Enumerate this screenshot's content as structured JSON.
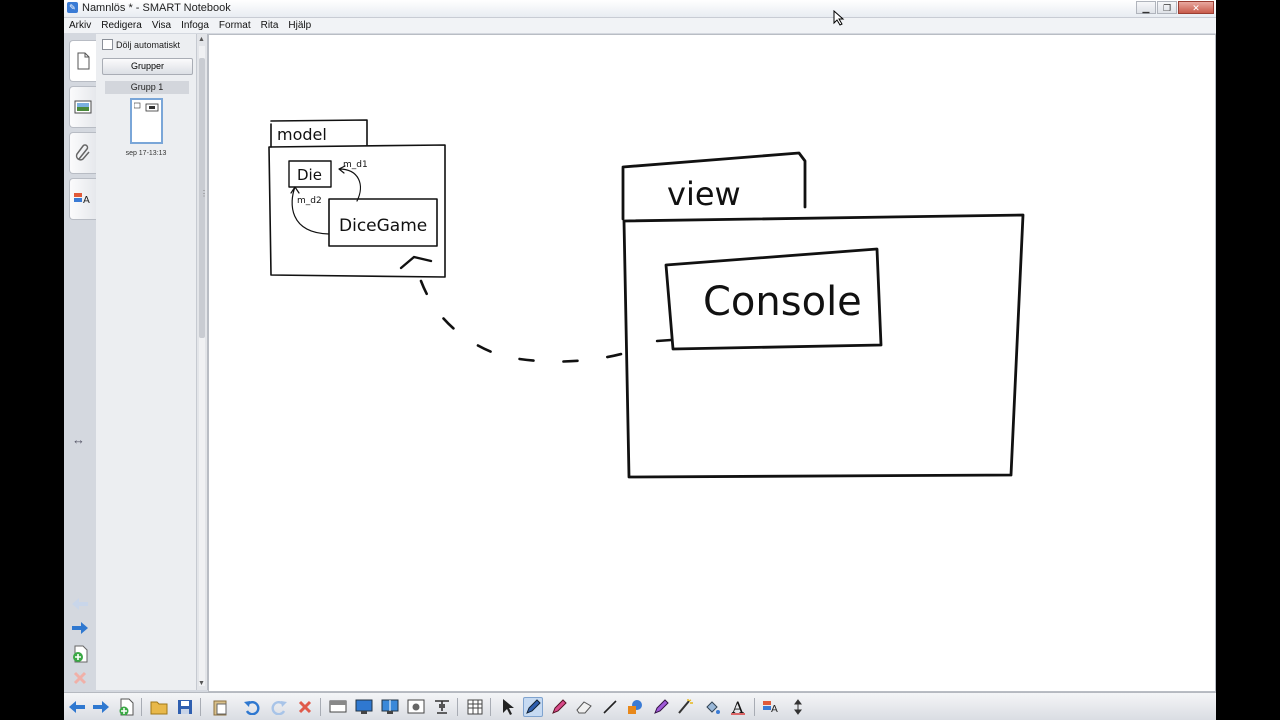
{
  "window": {
    "title": "Namnlös * - SMART Notebook",
    "minimize": "▁",
    "maximize": "❐",
    "close": "✕"
  },
  "menu": [
    "Arkiv",
    "Redigera",
    "Visa",
    "Infoga",
    "Format",
    "Rita",
    "Hjälp"
  ],
  "side_tabs": [
    {
      "name": "page-sorter-icon"
    },
    {
      "name": "gallery-icon"
    },
    {
      "name": "attachments-icon"
    },
    {
      "name": "properties-icon"
    }
  ],
  "panel": {
    "auto_hide_label": "Dölj automatiskt",
    "auto_hide_checked": false,
    "groups_button": "Grupper",
    "group_title": "Grupp 1",
    "thumbnail_date": "sep 17-13:13"
  },
  "diagram": {
    "model_label": "model",
    "die_label": "Die",
    "dicegame_label": "DiceGame",
    "m_d1_label": "m_d1",
    "m_d2_label": "m_d2",
    "view_label": "view",
    "console_label": "Console"
  },
  "toolbar": [
    "previous-page-icon",
    "next-page-icon",
    "add-page-icon",
    "open-file-icon",
    "save-icon",
    "paste-icon",
    "undo-icon",
    "redo-icon",
    "delete-icon",
    "screen-shade-icon",
    "full-screen-icon",
    "dual-page-icon",
    "screen-capture-icon",
    "document-camera-icon",
    "table-icon",
    "select-icon",
    "pen-icon",
    "creative-pen-icon",
    "eraser-icon",
    "line-icon",
    "shapes-icon",
    "magic-pen-icon",
    "shape-recognition-pen-icon",
    "fill-icon",
    "text-icon",
    "properties-icon",
    "move-toolbar-icon"
  ]
}
